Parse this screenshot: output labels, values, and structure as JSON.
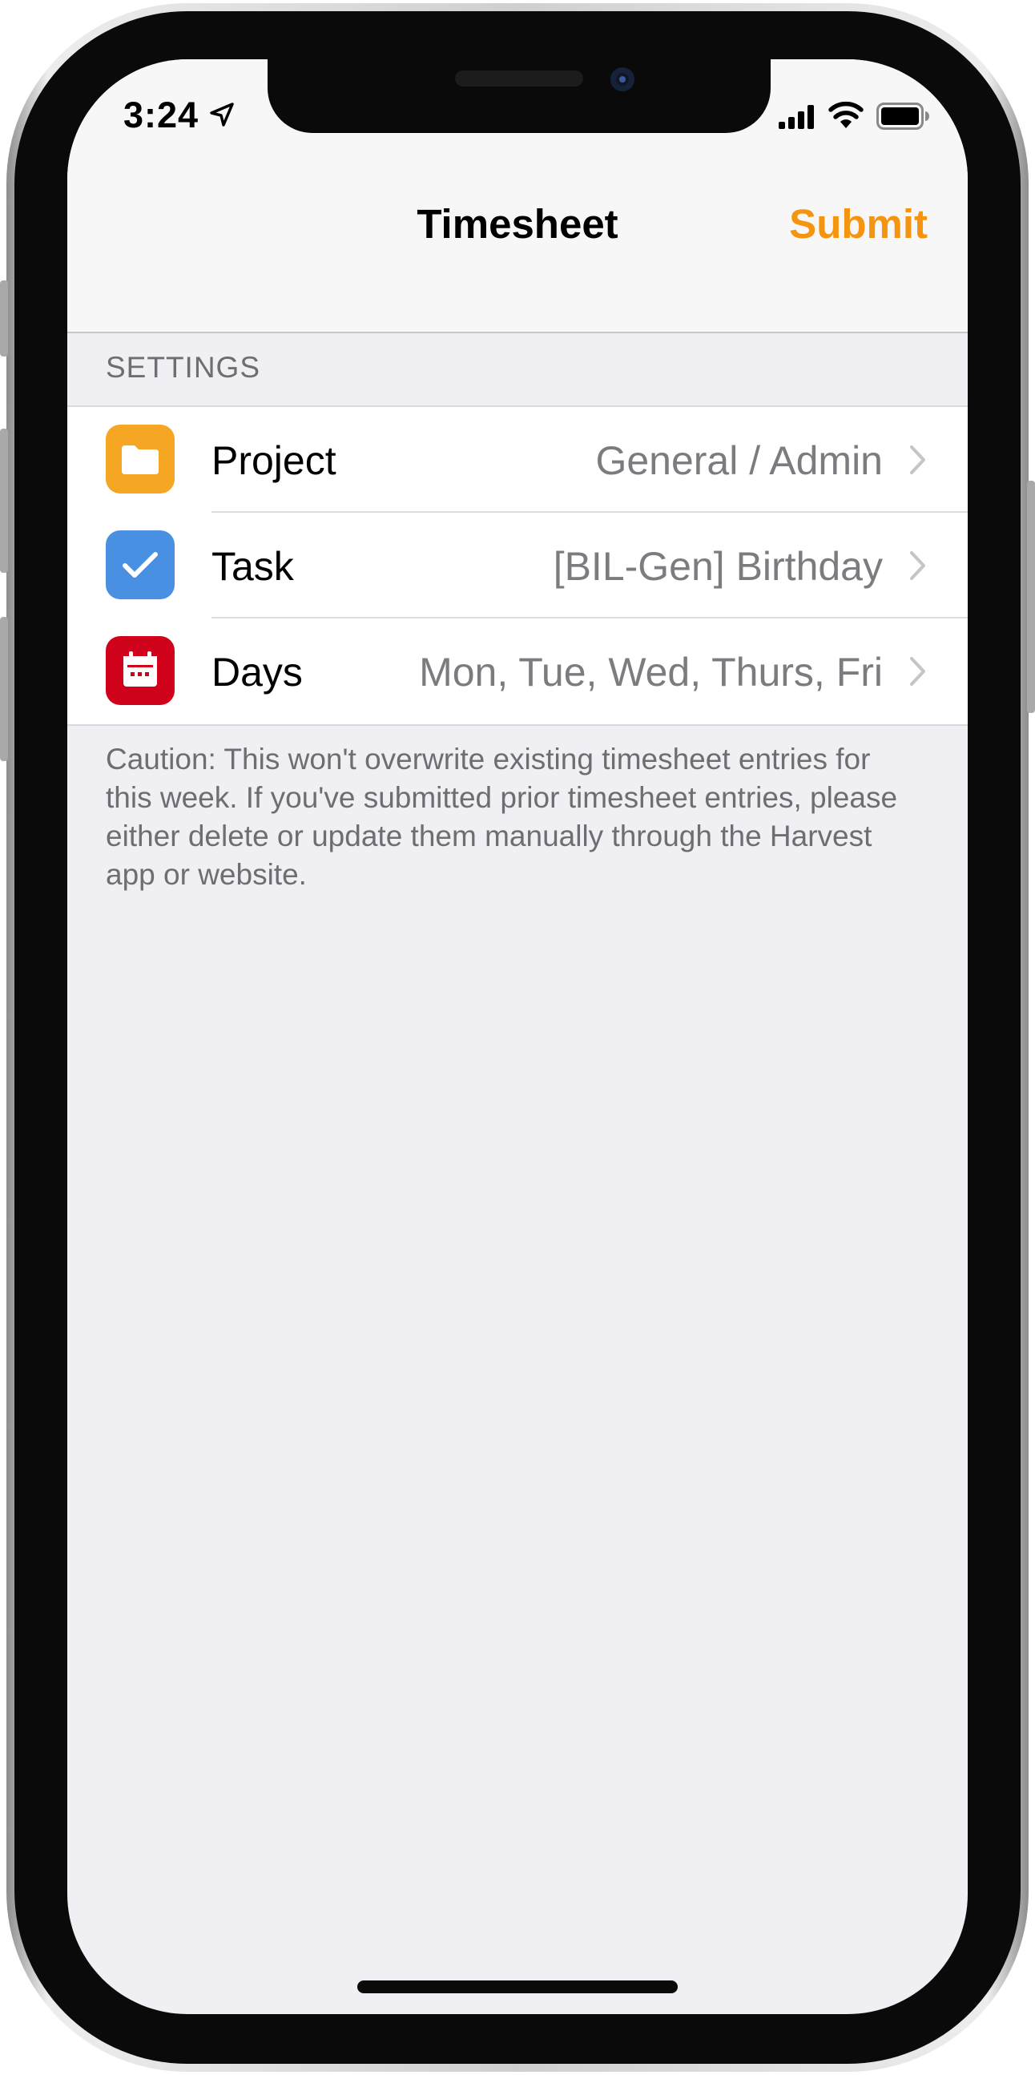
{
  "status_bar": {
    "time": "3:24",
    "icons": [
      "location-arrow-icon",
      "signal-icon",
      "wifi-icon",
      "battery-icon"
    ]
  },
  "nav": {
    "title": "Timesheet",
    "submit_label": "Submit"
  },
  "settings": {
    "header": "SETTINGS",
    "rows": [
      {
        "label": "Project",
        "value": "General / Admin",
        "icon": "folder-icon",
        "icon_color": "#f5a623"
      },
      {
        "label": "Task",
        "value": "[BIL-Gen] Birthday",
        "icon": "checkmark-icon",
        "icon_color": "#4a90e2"
      },
      {
        "label": "Days",
        "value": "Mon, Tue, Wed, Thurs, Fri",
        "icon": "calendar-icon",
        "icon_color": "#d0021b"
      }
    ]
  },
  "footer": {
    "caution": "Caution: This won't overwrite existing timesheet entries for this week. If you've submitted prior timesheet entries, please either delete or update them manually through the Harvest app or website."
  },
  "colors": {
    "accent": "#f5940f",
    "background": "#efeff4",
    "secondary_text": "#6d6d72"
  }
}
